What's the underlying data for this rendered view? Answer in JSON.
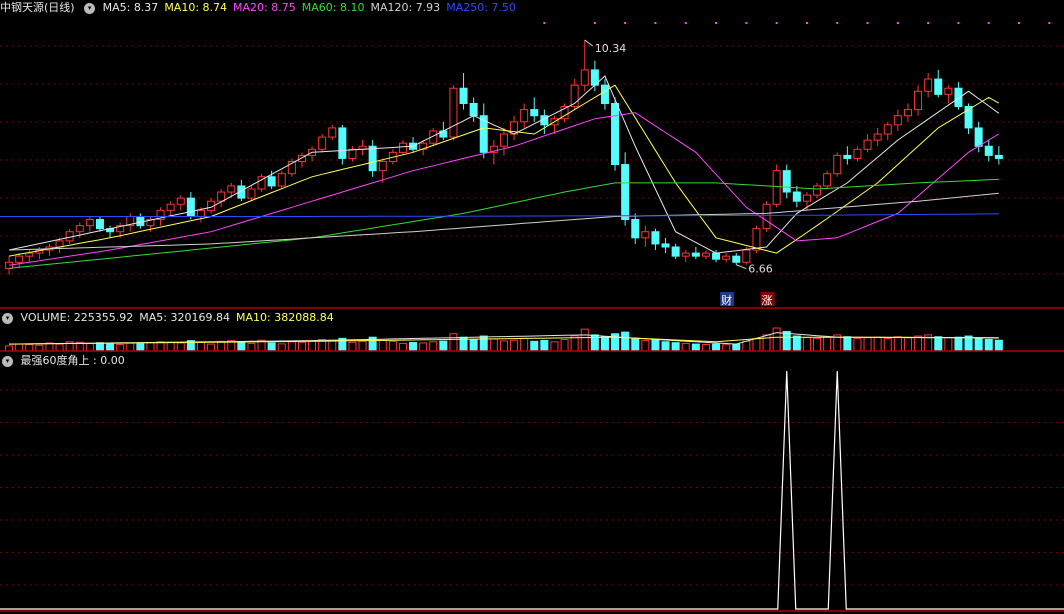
{
  "price_header": {
    "title": "中钢天源(日线)",
    "items": [
      {
        "label": "MA5: ",
        "value": "8.37",
        "color": "#e6e6e6"
      },
      {
        "label": "MA10: ",
        "value": "8.74",
        "color": "#ffff55"
      },
      {
        "label": "MA20: ",
        "value": "8.75",
        "color": "#ff44ff"
      },
      {
        "label": "MA60: ",
        "value": "8.10",
        "color": "#33dd33"
      },
      {
        "label": "MA120: ",
        "value": "7.93",
        "color": "#d0d0d0"
      },
      {
        "label": "MA250: ",
        "value": "7.50",
        "color": "#2a4bff"
      }
    ]
  },
  "volume_header": {
    "items": [
      {
        "label": "VOLUME: ",
        "value": "225355.92",
        "color": "#e6e6e6"
      },
      {
        "label": "MA5: ",
        "value": "320169.84",
        "color": "#e6e6e6"
      },
      {
        "label": "MA10: ",
        "value": "382088.84",
        "color": "#ffff55"
      }
    ]
  },
  "indicator_header": {
    "label": "最强60度角上 : ",
    "value": "0.00"
  },
  "markers": {
    "high_label": "10.34",
    "low_label": "6.66",
    "badge_cai": "财",
    "badge_zhang": "涨"
  },
  "colors": {
    "up": "#ff3232",
    "down": "#54fcfc",
    "grid": "#7a0000",
    "ma5": "#e6e6e6",
    "ma10": "#ffff55",
    "ma20": "#ff44ff",
    "ma60": "#33dd33",
    "ma120": "#d0d0d0",
    "ma250": "#2a4bff",
    "signal": "#ffffff",
    "border": "#b00000"
  },
  "chart_data": [
    {
      "type": "candlestick",
      "title": "中钢天源(日线)",
      "ylim": [
        6.0,
        10.7
      ],
      "high_point": 10.34,
      "low_point": 6.66,
      "ohlc": [
        [
          6.6,
          6.8,
          6.5,
          6.7
        ],
        [
          6.7,
          6.85,
          6.6,
          6.8
        ],
        [
          6.8,
          6.9,
          6.7,
          6.85
        ],
        [
          6.85,
          6.95,
          6.75,
          6.9
        ],
        [
          6.9,
          7.0,
          6.8,
          6.95
        ],
        [
          6.95,
          7.1,
          6.85,
          7.05
        ],
        [
          7.05,
          7.25,
          7.0,
          7.2
        ],
        [
          7.2,
          7.35,
          7.1,
          7.3
        ],
        [
          7.3,
          7.45,
          7.2,
          7.4
        ],
        [
          7.4,
          7.45,
          7.2,
          7.25
        ],
        [
          7.25,
          7.3,
          7.1,
          7.2
        ],
        [
          7.2,
          7.35,
          7.1,
          7.3
        ],
        [
          7.3,
          7.5,
          7.2,
          7.45
        ],
        [
          7.45,
          7.5,
          7.25,
          7.3
        ],
        [
          7.3,
          7.45,
          7.2,
          7.4
        ],
        [
          7.4,
          7.6,
          7.3,
          7.55
        ],
        [
          7.55,
          7.7,
          7.45,
          7.65
        ],
        [
          7.65,
          7.8,
          7.55,
          7.75
        ],
        [
          7.75,
          7.85,
          7.4,
          7.45
        ],
        [
          7.45,
          7.6,
          7.35,
          7.55
        ],
        [
          7.55,
          7.75,
          7.5,
          7.7
        ],
        [
          7.7,
          7.9,
          7.6,
          7.85
        ],
        [
          7.85,
          8.0,
          7.75,
          7.95
        ],
        [
          7.95,
          8.05,
          7.7,
          7.75
        ],
        [
          7.75,
          7.95,
          7.7,
          7.9
        ],
        [
          7.9,
          8.15,
          7.85,
          8.1
        ],
        [
          8.1,
          8.2,
          7.9,
          7.95
        ],
        [
          7.95,
          8.2,
          7.9,
          8.15
        ],
        [
          8.15,
          8.4,
          8.1,
          8.35
        ],
        [
          8.35,
          8.5,
          8.25,
          8.45
        ],
        [
          8.45,
          8.6,
          8.35,
          8.55
        ],
        [
          8.55,
          8.8,
          8.5,
          8.75
        ],
        [
          8.75,
          8.95,
          8.7,
          8.9
        ],
        [
          8.9,
          8.95,
          8.3,
          8.4
        ],
        [
          8.4,
          8.6,
          8.35,
          8.55
        ],
        [
          8.55,
          8.7,
          8.45,
          8.6
        ],
        [
          8.6,
          8.7,
          8.1,
          8.2
        ],
        [
          8.2,
          8.4,
          8.0,
          8.35
        ],
        [
          8.35,
          8.55,
          8.3,
          8.5
        ],
        [
          8.5,
          8.7,
          8.45,
          8.65
        ],
        [
          8.65,
          8.75,
          8.5,
          8.55
        ],
        [
          8.55,
          8.7,
          8.45,
          8.65
        ],
        [
          8.65,
          8.9,
          8.6,
          8.85
        ],
        [
          8.85,
          9.0,
          8.7,
          8.75
        ],
        [
          8.75,
          9.6,
          8.7,
          9.55
        ],
        [
          9.55,
          9.8,
          9.2,
          9.3
        ],
        [
          9.3,
          9.4,
          9.0,
          9.1
        ],
        [
          9.1,
          9.3,
          8.4,
          8.5
        ],
        [
          8.5,
          8.7,
          8.3,
          8.6
        ],
        [
          8.6,
          8.9,
          8.45,
          8.8
        ],
        [
          8.8,
          9.1,
          8.7,
          9.0
        ],
        [
          9.0,
          9.3,
          8.9,
          9.2
        ],
        [
          9.2,
          9.4,
          9.0,
          9.1
        ],
        [
          9.1,
          9.2,
          8.8,
          8.95
        ],
        [
          8.95,
          9.1,
          8.8,
          9.05
        ],
        [
          9.05,
          9.3,
          9.0,
          9.25
        ],
        [
          9.25,
          9.7,
          9.2,
          9.6
        ],
        [
          9.6,
          10.34,
          9.5,
          9.85
        ],
        [
          9.85,
          10.0,
          9.5,
          9.6
        ],
        [
          9.6,
          9.7,
          9.2,
          9.3
        ],
        [
          9.3,
          9.4,
          8.2,
          8.3
        ],
        [
          8.3,
          8.5,
          7.3,
          7.4
        ],
        [
          7.4,
          7.5,
          7.0,
          7.1
        ],
        [
          7.1,
          7.3,
          6.95,
          7.2
        ],
        [
          7.2,
          7.25,
          6.9,
          7.0
        ],
        [
          7.0,
          7.1,
          6.85,
          6.95
        ],
        [
          6.95,
          7.0,
          6.75,
          6.8
        ],
        [
          6.8,
          6.9,
          6.7,
          6.85
        ],
        [
          6.85,
          6.95,
          6.75,
          6.8
        ],
        [
          6.8,
          6.9,
          6.75,
          6.85
        ],
        [
          6.85,
          6.9,
          6.7,
          6.75
        ],
        [
          6.75,
          6.85,
          6.7,
          6.8
        ],
        [
          6.8,
          6.85,
          6.66,
          6.7
        ],
        [
          6.7,
          6.95,
          6.66,
          6.9
        ],
        [
          6.9,
          7.3,
          6.85,
          7.25
        ],
        [
          7.25,
          7.7,
          7.2,
          7.65
        ],
        [
          7.65,
          8.3,
          7.6,
          8.2
        ],
        [
          8.2,
          8.3,
          7.75,
          7.85
        ],
        [
          7.85,
          7.95,
          7.6,
          7.7
        ],
        [
          7.7,
          7.85,
          7.55,
          7.8
        ],
        [
          7.8,
          8.0,
          7.75,
          7.95
        ],
        [
          7.95,
          8.2,
          7.9,
          8.15
        ],
        [
          8.15,
          8.5,
          8.1,
          8.45
        ],
        [
          8.45,
          8.6,
          8.3,
          8.4
        ],
        [
          8.4,
          8.6,
          8.35,
          8.55
        ],
        [
          8.55,
          8.8,
          8.5,
          8.7
        ],
        [
          8.7,
          8.9,
          8.6,
          8.8
        ],
        [
          8.8,
          9.0,
          8.7,
          8.95
        ],
        [
          8.95,
          9.2,
          8.85,
          9.1
        ],
        [
          9.1,
          9.3,
          9.0,
          9.2
        ],
        [
          9.2,
          9.6,
          9.1,
          9.5
        ],
        [
          9.5,
          9.8,
          9.4,
          9.7
        ],
        [
          9.7,
          9.85,
          9.4,
          9.45
        ],
        [
          9.45,
          9.6,
          9.3,
          9.55
        ],
        [
          9.55,
          9.65,
          9.2,
          9.25
        ],
        [
          9.25,
          9.3,
          8.8,
          8.9
        ],
        [
          8.9,
          9.0,
          8.5,
          8.6
        ],
        [
          8.6,
          8.7,
          8.35,
          8.45
        ],
        [
          8.45,
          8.6,
          8.3,
          8.4
        ]
      ],
      "moving_averages": {
        "MA5": {
          "anchors": [
            [
              0,
              6.9
            ],
            [
              10,
              7.25
            ],
            [
              20,
              7.6
            ],
            [
              30,
              8.5
            ],
            [
              40,
              8.6
            ],
            [
              46,
              9.1
            ],
            [
              50,
              8.8
            ],
            [
              56,
              9.3
            ],
            [
              59,
              9.75
            ],
            [
              62,
              8.6
            ],
            [
              66,
              7.2
            ],
            [
              70,
              6.85
            ],
            [
              75,
              6.95
            ],
            [
              78,
              7.5
            ],
            [
              83,
              8.0
            ],
            [
              88,
              8.7
            ],
            [
              95,
              9.5
            ],
            [
              100,
              8.9
            ],
            [
              104,
              8.4
            ]
          ]
        },
        "MA10": {
          "anchors": [
            [
              0,
              6.8
            ],
            [
              10,
              7.1
            ],
            [
              20,
              7.45
            ],
            [
              30,
              8.1
            ],
            [
              40,
              8.5
            ],
            [
              47,
              8.9
            ],
            [
              52,
              8.8
            ],
            [
              60,
              9.6
            ],
            [
              66,
              8.0
            ],
            [
              70,
              7.1
            ],
            [
              76,
              6.85
            ],
            [
              80,
              7.3
            ],
            [
              86,
              8.0
            ],
            [
              92,
              8.9
            ],
            [
              97,
              9.4
            ],
            [
              104,
              8.74
            ]
          ]
        },
        "MA20": {
          "anchors": [
            [
              0,
              6.65
            ],
            [
              10,
              6.9
            ],
            [
              20,
              7.2
            ],
            [
              30,
              7.7
            ],
            [
              40,
              8.2
            ],
            [
              50,
              8.6
            ],
            [
              58,
              9.05
            ],
            [
              62,
              9.15
            ],
            [
              68,
              8.5
            ],
            [
              73,
              7.6
            ],
            [
              78,
              7.05
            ],
            [
              82,
              7.1
            ],
            [
              88,
              7.5
            ],
            [
              95,
              8.5
            ],
            [
              100,
              9.0
            ],
            [
              104,
              8.75
            ]
          ]
        },
        "MA60": {
          "anchors": [
            [
              0,
              6.6
            ],
            [
              15,
              6.85
            ],
            [
              30,
              7.1
            ],
            [
              45,
              7.5
            ],
            [
              55,
              7.85
            ],
            [
              60,
              8.0
            ],
            [
              70,
              8.0
            ],
            [
              80,
              7.9
            ],
            [
              90,
              8.0
            ],
            [
              104,
              8.1
            ]
          ]
        },
        "MA120": {
          "anchors": [
            [
              0,
              6.9
            ],
            [
              20,
              7.0
            ],
            [
              40,
              7.2
            ],
            [
              60,
              7.45
            ],
            [
              75,
              7.5
            ],
            [
              90,
              7.7
            ],
            [
              104,
              7.93
            ]
          ]
        },
        "MA250": {
          "anchors": [
            [
              0,
              7.45
            ],
            [
              30,
              7.45
            ],
            [
              60,
              7.46
            ],
            [
              80,
              7.47
            ],
            [
              104,
              7.5
            ]
          ]
        }
      }
    },
    {
      "type": "bar",
      "title": "VOLUME",
      "values": [
        0.22,
        0.3,
        0.28,
        0.25,
        0.35,
        0.3,
        0.4,
        0.38,
        0.33,
        0.36,
        0.3,
        0.28,
        0.34,
        0.31,
        0.36,
        0.4,
        0.38,
        0.35,
        0.45,
        0.37,
        0.3,
        0.42,
        0.45,
        0.37,
        0.33,
        0.47,
        0.35,
        0.31,
        0.4,
        0.38,
        0.42,
        0.5,
        0.47,
        0.55,
        0.38,
        0.42,
        0.6,
        0.46,
        0.42,
        0.33,
        0.37,
        0.35,
        0.4,
        0.43,
        0.75,
        0.6,
        0.48,
        0.65,
        0.52,
        0.44,
        0.47,
        0.55,
        0.42,
        0.46,
        0.4,
        0.5,
        0.66,
        0.95,
        0.7,
        0.62,
        0.75,
        0.82,
        0.55,
        0.45,
        0.48,
        0.4,
        0.36,
        0.33,
        0.3,
        0.28,
        0.3,
        0.27,
        0.3,
        0.42,
        0.55,
        0.7,
        1.0,
        0.85,
        0.65,
        0.58,
        0.55,
        0.6,
        0.7,
        0.62,
        0.55,
        0.58,
        0.6,
        0.55,
        0.62,
        0.58,
        0.65,
        0.7,
        0.62,
        0.58,
        0.6,
        0.65,
        0.55,
        0.5,
        0.47
      ],
      "ma5": {
        "anchors": [
          [
            0,
            0.3
          ],
          [
            30,
            0.45
          ],
          [
            57,
            0.7
          ],
          [
            66,
            0.45
          ],
          [
            72,
            0.3
          ],
          [
            76,
            0.8
          ],
          [
            82,
            0.6
          ],
          [
            104,
            0.55
          ]
        ]
      },
      "ma10": {
        "anchors": [
          [
            0,
            0.3
          ],
          [
            30,
            0.42
          ],
          [
            60,
            0.6
          ],
          [
            70,
            0.4
          ],
          [
            76,
            0.6
          ],
          [
            85,
            0.6
          ],
          [
            104,
            0.57
          ]
        ]
      }
    },
    {
      "type": "line",
      "title": "最强60度角上",
      "ylim": [
        0,
        1
      ],
      "values": {
        "spikes": [
          77,
          82
        ],
        "peak": 1,
        "base": 0
      }
    }
  ]
}
